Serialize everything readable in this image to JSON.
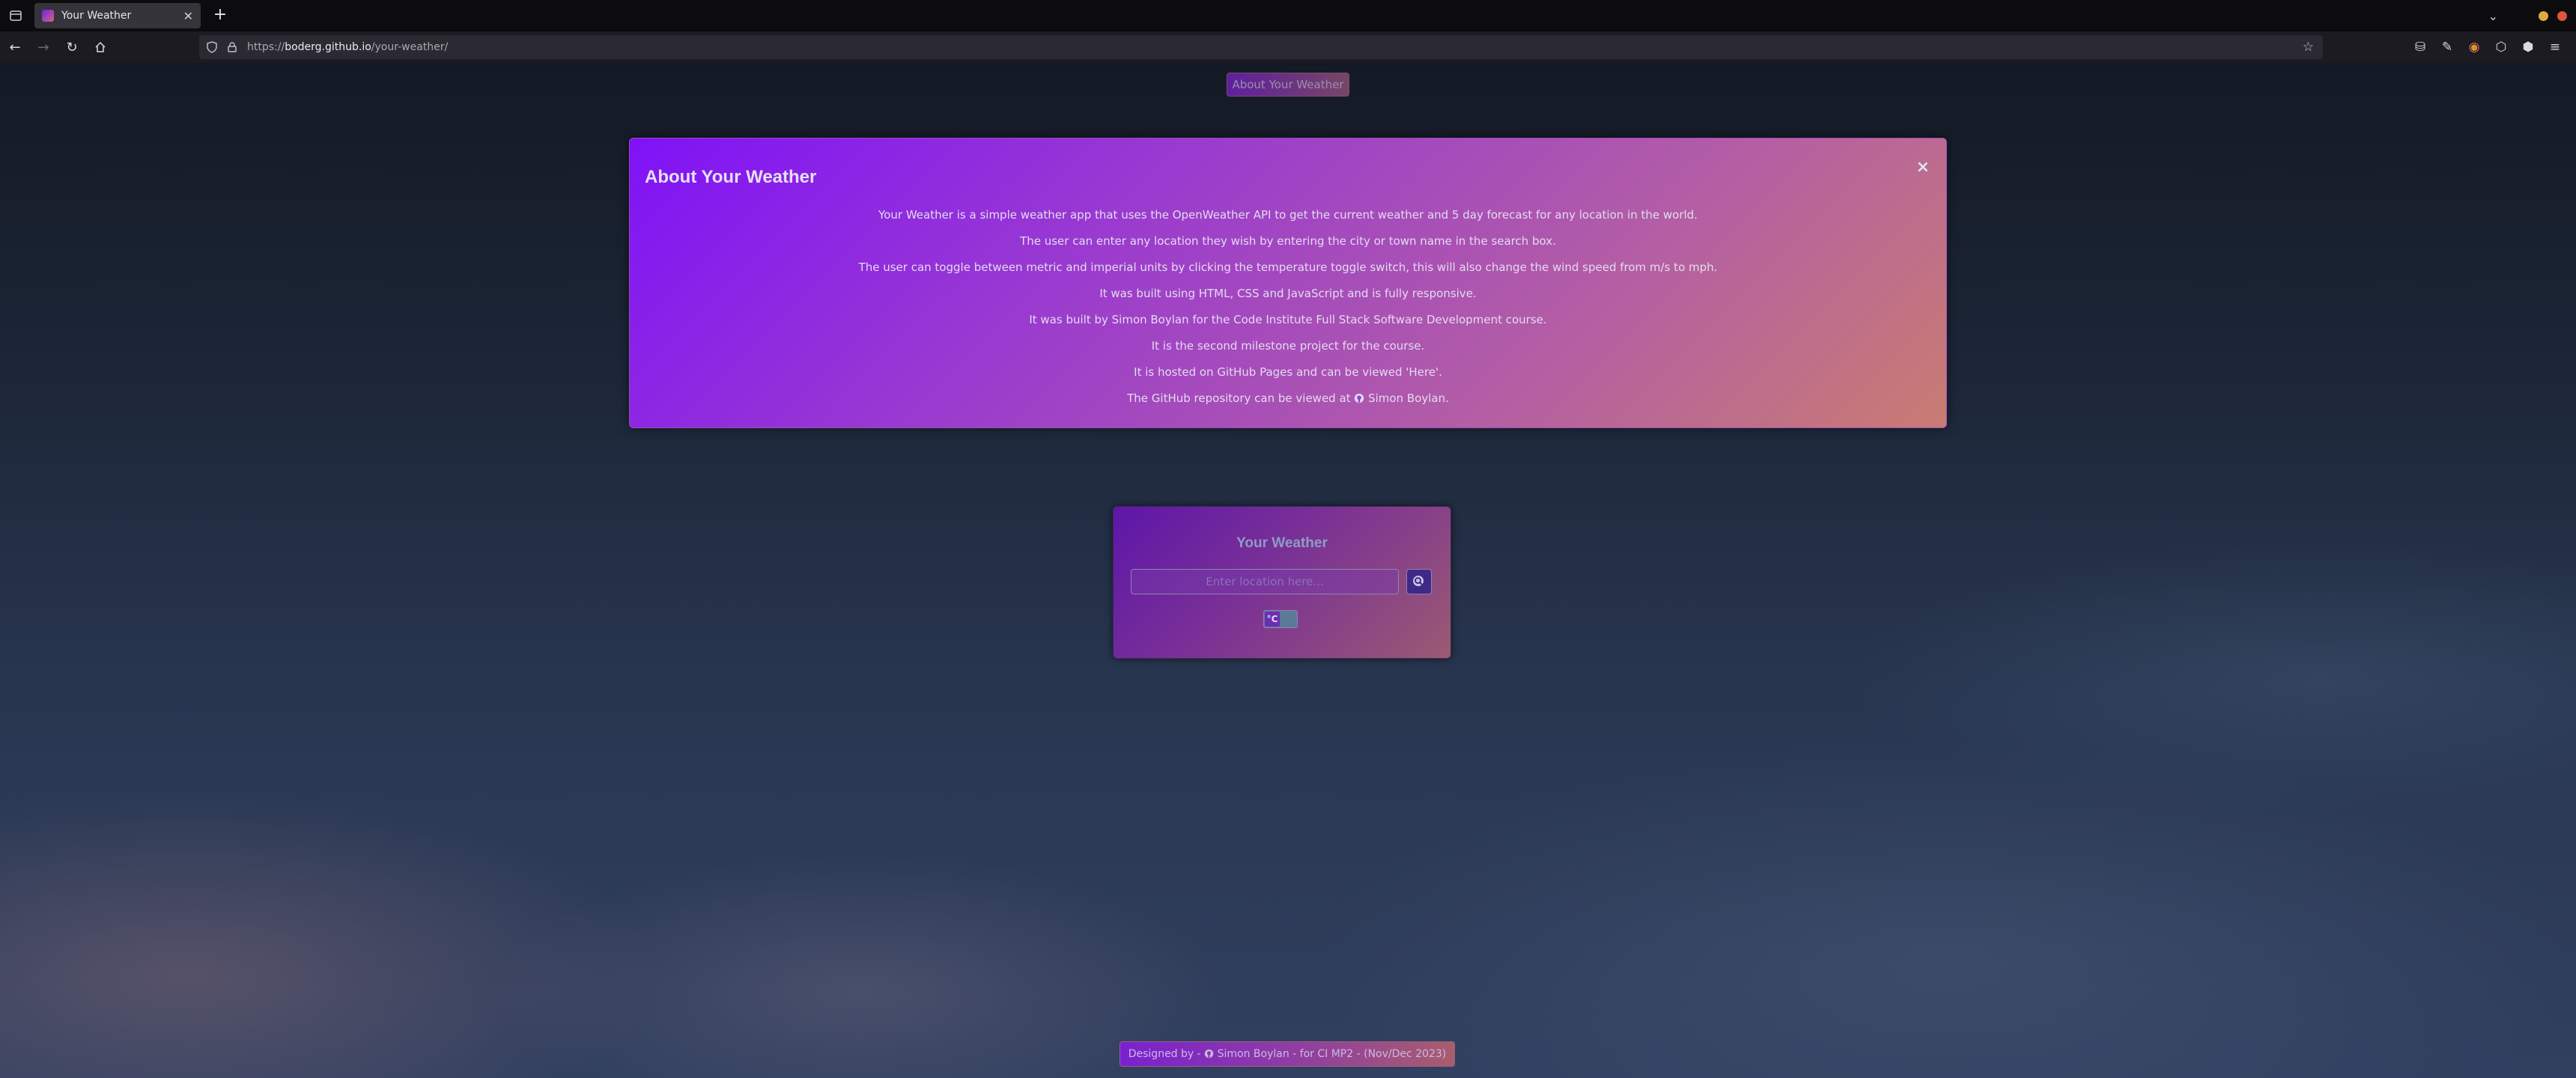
{
  "browser": {
    "tab": {
      "title": "Your Weather"
    },
    "url": {
      "scheme": "https://",
      "host": "boderg.github.io",
      "path": "/your-weather/"
    }
  },
  "page": {
    "about_button_label": "About Your Weather",
    "modal": {
      "title": "About Your Weather",
      "close_label": "×",
      "lines": [
        "Your Weather is a simple weather app that uses the OpenWeather API to get the current weather and 5 day forecast for any location in the world.",
        "The user can enter any location they wish by entering the city or town name in the search box.",
        "The user can toggle between metric and imperial units by clicking the temperature toggle switch, this will also change the wind speed from m/s to mph.",
        "It was built using HTML, CSS and JavaScript and is fully responsive.",
        "It was built by Simon Boylan for the Code Institute Full Stack Software Development course.",
        "It is the second milestone project for the course.",
        "It is hosted on GitHub Pages and can be viewed 'Here'."
      ],
      "last_line_prefix": "The GitHub repository can be viewed at",
      "last_line_link": "Simon Boylan."
    },
    "card": {
      "title": "Your Weather",
      "search_placeholder": "Enter location here...",
      "toggle_label": "°C"
    },
    "footer": {
      "prefix": "Designed by -",
      "link": "Simon Boylan",
      "suffix": "- for CI MP2 - (Nov/Dec 2023)"
    }
  },
  "icons": {
    "tab_list": "tab-list-icon",
    "favicon": "favicon-icon",
    "tab_close": "close-icon",
    "new_tab": "plus-icon",
    "back": "back-arrow-icon",
    "forward": "forward-arrow-icon",
    "reload": "reload-icon",
    "home": "home-icon",
    "shield": "shield-icon",
    "lock": "lock-icon",
    "bookmark": "star-icon",
    "github": "github-icon",
    "search": "search-icon",
    "menu": "hamburger-menu-icon"
  },
  "colors": {
    "modal_gradient_start": "#7f12f7",
    "modal_gradient_end": "#c97c72",
    "card_gradient_start": "#5d16a8",
    "card_gradient_end": "#9b5a72"
  }
}
